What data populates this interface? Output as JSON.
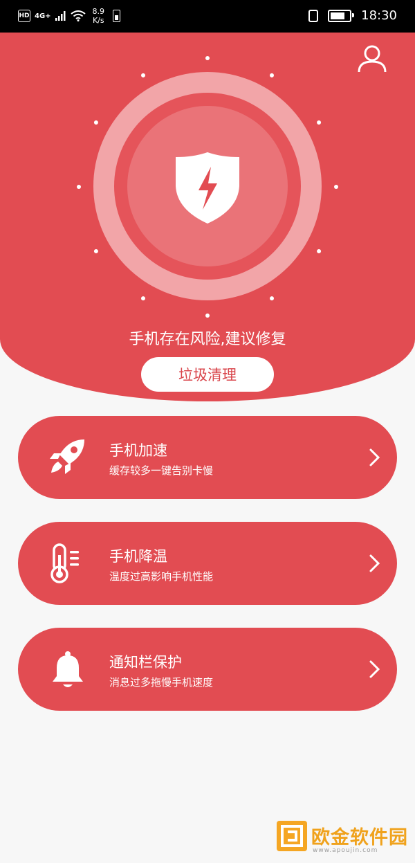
{
  "status_bar": {
    "hd": "HD",
    "network": "4G+",
    "speed_value": "8.9",
    "speed_unit": "K/s",
    "time": "18:30"
  },
  "header": {
    "risk_text": "手机存在风险,建议修复",
    "clean_button": "垃圾清理",
    "shield_icon": "shield-lightning-icon",
    "user_icon": "user-icon"
  },
  "features": [
    {
      "title": "手机加速",
      "subtitle": "缓存较多一键告别卡慢",
      "icon": "rocket-icon"
    },
    {
      "title": "手机降温",
      "subtitle": "温度过高影响手机性能",
      "icon": "thermometer-icon"
    },
    {
      "title": "通知栏保护",
      "subtitle": "消息过多拖慢手机速度",
      "icon": "bell-icon"
    }
  ],
  "watermark": {
    "text": "欧金软件园",
    "url": "www.apoujin.com"
  },
  "colors": {
    "primary": "#e24c52",
    "ring_outer": "#f2a5a8",
    "ring_inner": "#ea7378",
    "background": "#f7f7f7"
  }
}
